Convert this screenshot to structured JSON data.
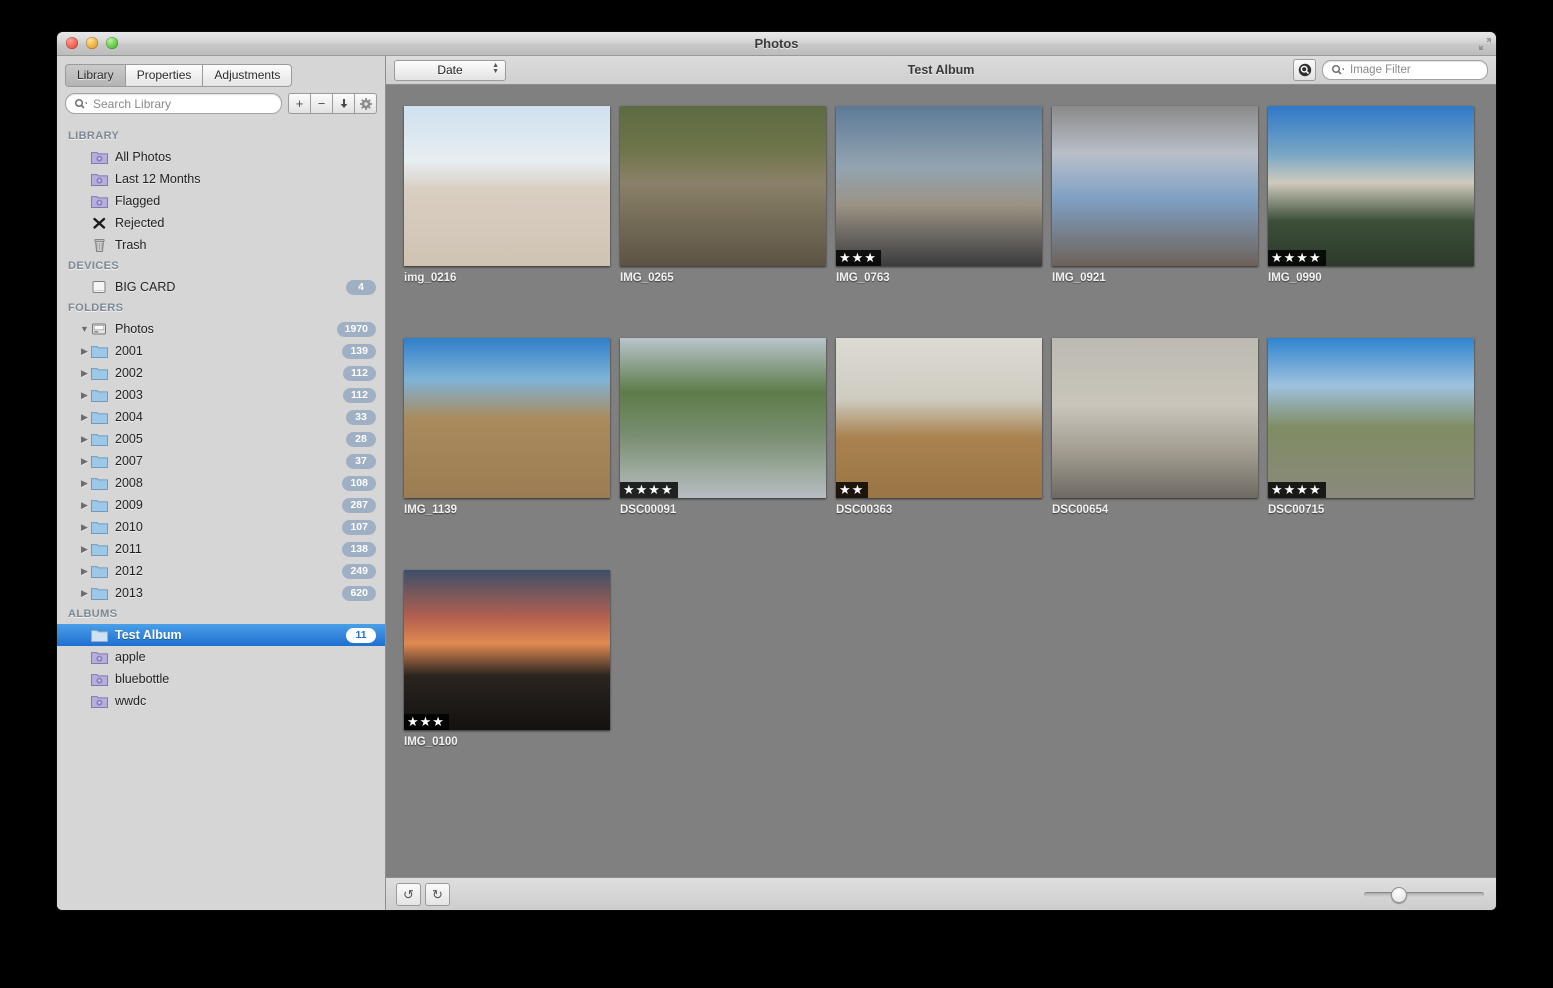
{
  "window": {
    "title": "Photos",
    "traffic_lights": [
      "close",
      "minimize",
      "zoom"
    ]
  },
  "sidebar": {
    "tabs": [
      {
        "label": "Library",
        "active": true
      },
      {
        "label": "Properties",
        "active": false
      },
      {
        "label": "Adjustments",
        "active": false
      }
    ],
    "search": {
      "placeholder": "Search Library",
      "value": ""
    },
    "mini_buttons": [
      {
        "name": "add-button",
        "glyph": "+"
      },
      {
        "name": "remove-button",
        "glyph": "−"
      },
      {
        "name": "import-button",
        "glyph": "⬇"
      },
      {
        "name": "settings-button",
        "glyph": "⚙"
      }
    ],
    "sections": [
      {
        "header": "LIBRARY",
        "items": [
          {
            "label": "All Photos",
            "icon": "smart-album-icon",
            "badge": ""
          },
          {
            "label": "Last 12 Months",
            "icon": "smart-album-icon",
            "badge": ""
          },
          {
            "label": "Flagged",
            "icon": "smart-album-icon",
            "badge": ""
          },
          {
            "label": "Rejected",
            "icon": "x-mark-icon",
            "badge": ""
          },
          {
            "label": "Trash",
            "icon": "trash-icon",
            "badge": ""
          }
        ]
      },
      {
        "header": "DEVICES",
        "items": [
          {
            "label": "BIG CARD",
            "icon": "card-icon",
            "badge": "4"
          }
        ]
      },
      {
        "header": "FOLDERS",
        "items": [
          {
            "label": "Photos",
            "icon": "drive-icon",
            "badge": "1970",
            "disclosure": "down",
            "level": 0
          },
          {
            "label": "2001",
            "icon": "folder-icon",
            "badge": "139",
            "disclosure": "right",
            "level": 1
          },
          {
            "label": "2002",
            "icon": "folder-icon",
            "badge": "112",
            "disclosure": "right",
            "level": 1
          },
          {
            "label": "2003",
            "icon": "folder-icon",
            "badge": "112",
            "disclosure": "right",
            "level": 1
          },
          {
            "label": "2004",
            "icon": "folder-icon",
            "badge": "33",
            "disclosure": "right",
            "level": 1
          },
          {
            "label": "2005",
            "icon": "folder-icon",
            "badge": "28",
            "disclosure": "right",
            "level": 1
          },
          {
            "label": "2007",
            "icon": "folder-icon",
            "badge": "37",
            "disclosure": "right",
            "level": 1
          },
          {
            "label": "2008",
            "icon": "folder-icon",
            "badge": "108",
            "disclosure": "right",
            "level": 1
          },
          {
            "label": "2009",
            "icon": "folder-icon",
            "badge": "287",
            "disclosure": "right",
            "level": 1
          },
          {
            "label": "2010",
            "icon": "folder-icon",
            "badge": "107",
            "disclosure": "right",
            "level": 1
          },
          {
            "label": "2011",
            "icon": "folder-icon",
            "badge": "138",
            "disclosure": "right",
            "level": 1
          },
          {
            "label": "2012",
            "icon": "folder-icon",
            "badge": "249",
            "disclosure": "right",
            "level": 1
          },
          {
            "label": "2013",
            "icon": "folder-icon",
            "badge": "620",
            "disclosure": "right",
            "level": 1
          }
        ]
      },
      {
        "header": "ALBUMS",
        "items": [
          {
            "label": "Test Album",
            "icon": "album-icon",
            "badge": "11",
            "selected": true
          },
          {
            "label": "apple",
            "icon": "smart-album-icon",
            "badge": ""
          },
          {
            "label": "bluebottle",
            "icon": "smart-album-icon",
            "badge": ""
          },
          {
            "label": "wwdc",
            "icon": "smart-album-icon",
            "badge": ""
          }
        ]
      }
    ]
  },
  "content": {
    "sort_popup": {
      "value": "Date"
    },
    "title": "Test Album",
    "search_toggle_icon": "magnifier-badge-icon",
    "filter": {
      "placeholder": "Image Filter",
      "value": ""
    },
    "photos": [
      {
        "name": "img_0216",
        "stars": 0,
        "orientation": "landscape",
        "scene": "museum-plaza"
      },
      {
        "name": "IMG_0265",
        "stars": 0,
        "orientation": "landscape",
        "scene": "campsite-logs"
      },
      {
        "name": "IMG_0763",
        "stars": 3,
        "orientation": "landscape",
        "scene": "statue-dusk"
      },
      {
        "name": "IMG_0921",
        "stars": 0,
        "orientation": "landscape",
        "scene": "building-fire"
      },
      {
        "name": "IMG_0990",
        "stars": 4,
        "orientation": "landscape",
        "scene": "granite-dome-lake"
      },
      {
        "name": "IMG_1139",
        "stars": 0,
        "orientation": "landscape",
        "scene": "coastal-trail-backpack"
      },
      {
        "name": "DSC00091",
        "stars": 4,
        "orientation": "landscape",
        "scene": "street-parked-cars"
      },
      {
        "name": "DSC00363",
        "stars": 2,
        "orientation": "landscape",
        "scene": "shoes-hallway"
      },
      {
        "name": "DSC00654",
        "stars": 0,
        "orientation": "landscape",
        "scene": "museum-marbles"
      },
      {
        "name": "DSC00715",
        "stars": 4,
        "orientation": "landscape",
        "scene": "stone-wall-gate"
      },
      {
        "name": "IMG_0100",
        "stars": 3,
        "orientation": "landscape",
        "scene": "sunset-rooftops"
      }
    ]
  },
  "bottom_bar": {
    "rotate_ccw_label": "↺",
    "rotate_cw_label": "↻",
    "zoom_slider_percent": 28
  },
  "colors": {
    "selection_blue": "#2272cf",
    "badge_blue": "#9fb0c4",
    "content_bg": "#808080",
    "sidebar_bg": "#d6d6d6"
  }
}
